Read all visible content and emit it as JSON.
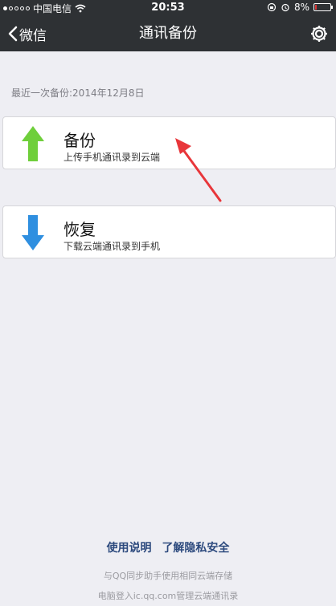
{
  "status_bar": {
    "carrier": "中国电信",
    "time": "20:53",
    "battery": "8%",
    "battery_level": 0.08
  },
  "nav": {
    "back_label": "微信",
    "title": "通讯备份",
    "settings_icon": "gear-icon"
  },
  "last_backup": "最近一次备份:2014年12月8日",
  "backup_card": {
    "title": "备份",
    "subtitle": "上传手机通讯录到云端",
    "icon": "arrow-up-icon",
    "color": "#6fcf3b"
  },
  "restore_card": {
    "title": "恢复",
    "subtitle": "下载云端通讯录到手机",
    "icon": "arrow-down-icon",
    "color": "#2f8fe0"
  },
  "links": {
    "usage": "使用说明",
    "privacy": "了解隐私安全"
  },
  "footer": {
    "line1": "与QQ同步助手使用相同云端存储",
    "line2": "电脑登入ic.qq.com管理云端通讯录"
  },
  "annotation_color": "#e8363a"
}
